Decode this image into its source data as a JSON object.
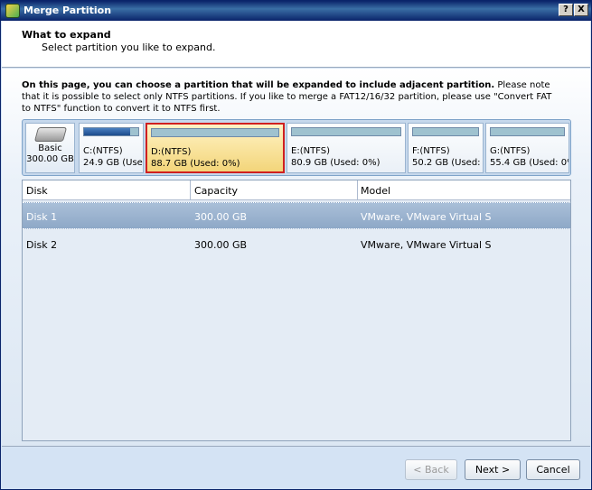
{
  "window": {
    "title": "Merge Partition",
    "help_label": "?",
    "close_label": "X"
  },
  "header": {
    "title": "What to expand",
    "subtitle": "Select partition you like to expand."
  },
  "description": {
    "bold": "On this page, you can choose a partition that will be expanded to include adjacent partition.",
    "rest": " Please note that it is possible to select only NTFS partitions. If you like to merge a FAT12/16/32 partition, please use \"Convert FAT to NTFS\" function to convert it to NTFS first."
  },
  "disk_map": {
    "disk": {
      "type": "Basic",
      "size": "300.00 GB"
    },
    "partitions": [
      {
        "name": "C:(NTFS)",
        "info": "24.9 GB (Used",
        "used_fraction": 0.85,
        "selected": false
      },
      {
        "name": "D:(NTFS)",
        "info": "88.7 GB (Used: 0%)",
        "used_fraction": 0.0,
        "selected": true
      },
      {
        "name": "E:(NTFS)",
        "info": "80.9 GB (Used: 0%)",
        "used_fraction": 0.0,
        "selected": false
      },
      {
        "name": "F:(NTFS)",
        "info": "50.2 GB (Used: 0",
        "used_fraction": 0.0,
        "selected": false
      },
      {
        "name": "G:(NTFS)",
        "info": "55.4 GB (Used: 0%",
        "used_fraction": 0.0,
        "selected": false
      }
    ]
  },
  "disk_table": {
    "columns": [
      "Disk",
      "Capacity",
      "Model"
    ],
    "rows": [
      {
        "disk": "Disk 1",
        "capacity": "300.00 GB",
        "model": "VMware, VMware Virtual S",
        "selected": true
      },
      {
        "disk": "Disk 2",
        "capacity": "300.00 GB",
        "model": "VMware, VMware Virtual S",
        "selected": false
      }
    ]
  },
  "buttons": {
    "back": "< Back",
    "next": "Next >",
    "cancel": "Cancel"
  }
}
